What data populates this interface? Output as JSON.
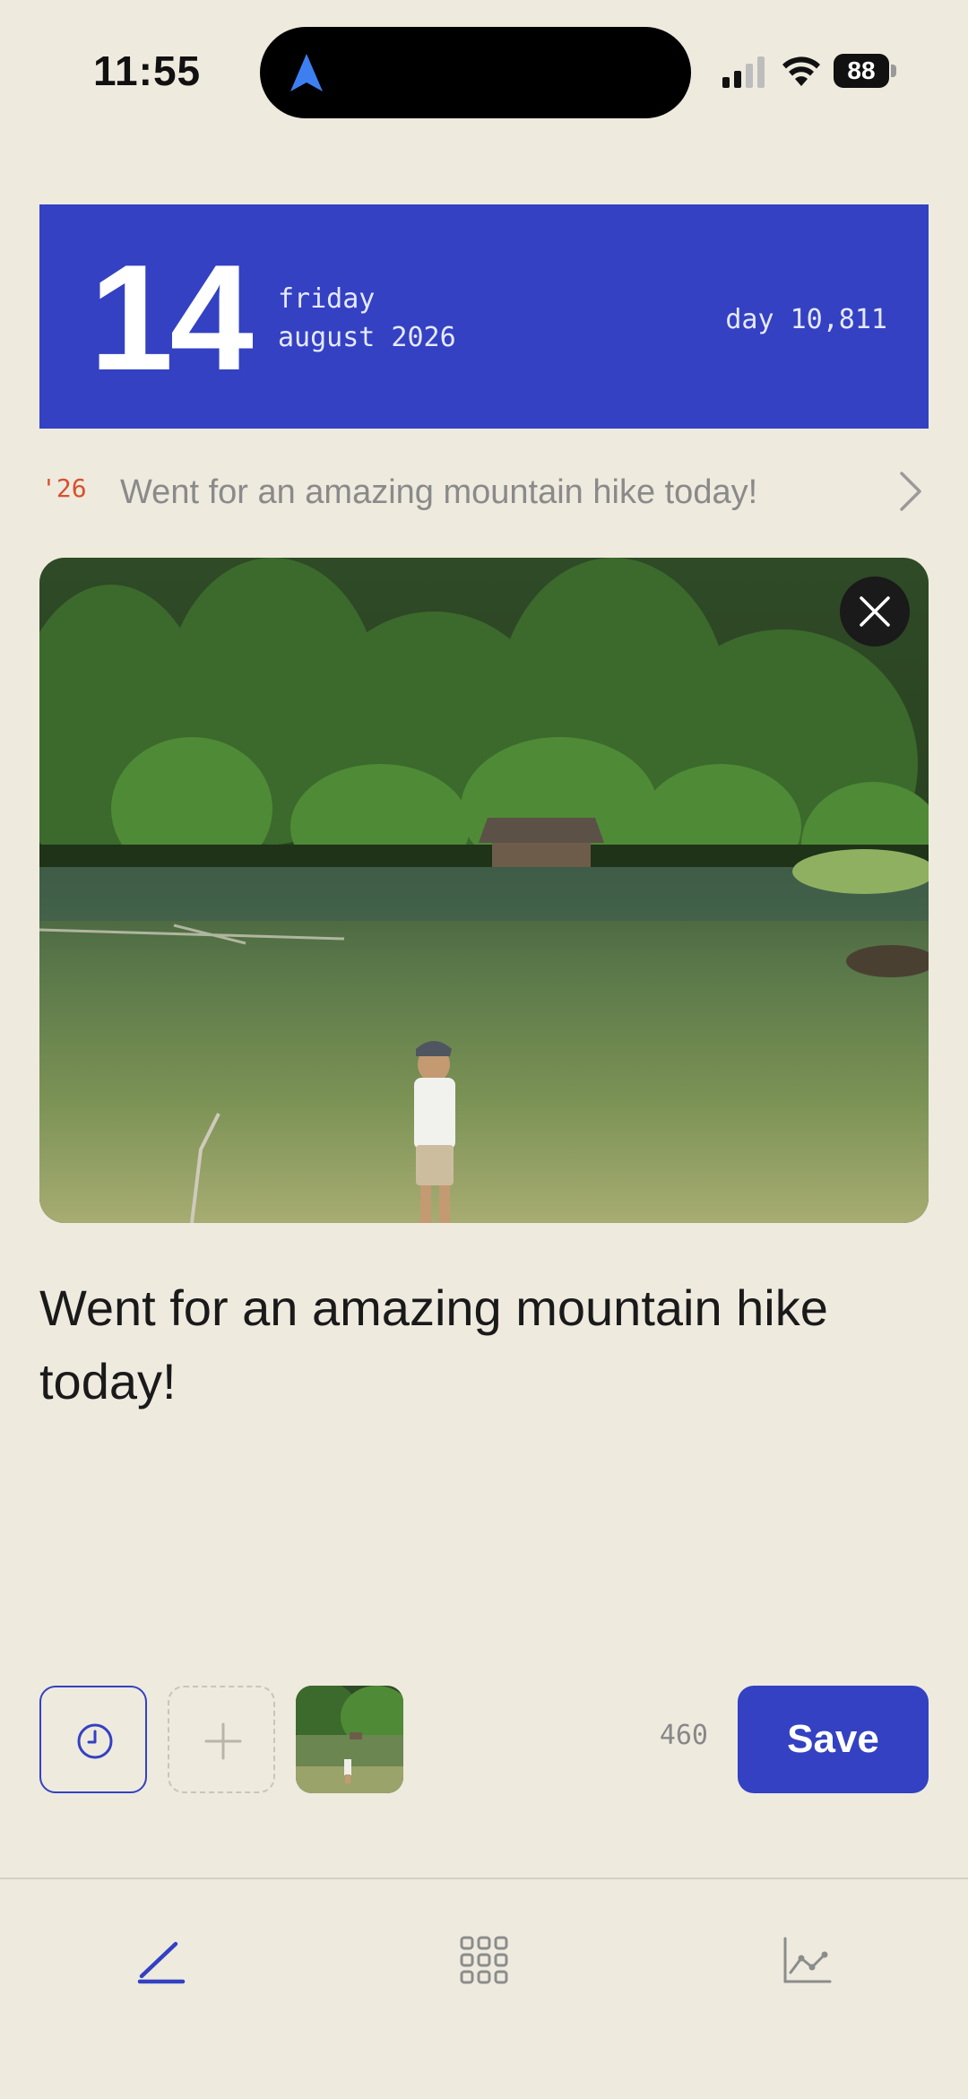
{
  "status_bar": {
    "time": "11:55",
    "battery": "88"
  },
  "date_header": {
    "day_number": "14",
    "weekday": "friday",
    "month_year": "august 2026",
    "day_count": "day 10,811"
  },
  "memory": {
    "year": "'26",
    "text": "Went for an amazing mountain hike today!"
  },
  "entry": {
    "text": "Went for an amazing mountain hike today!"
  },
  "toolbar": {
    "char_count": "460",
    "save_label": "Save"
  },
  "bottom_nav": {
    "items": [
      {
        "icon": "pencil-icon",
        "active": true
      },
      {
        "icon": "grid-icon",
        "active": false
      },
      {
        "icon": "chart-icon",
        "active": false
      }
    ]
  },
  "colors": {
    "background": "#eeeade",
    "accent": "#3341c2",
    "memory_year": "#d8502e"
  }
}
